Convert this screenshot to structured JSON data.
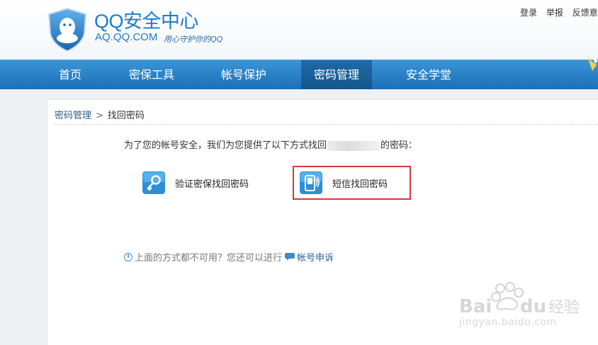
{
  "header": {
    "logo_title": "QQ安全中心",
    "logo_domain": "AQ.QQ.COM",
    "logo_slogan": "用心守护你的QQ",
    "top_links": [
      "登录",
      "举报",
      "反馈意见"
    ]
  },
  "nav": {
    "items": [
      {
        "label": "首页",
        "active": false
      },
      {
        "label": "密保工具",
        "active": false
      },
      {
        "label": "帐号保护",
        "active": false
      },
      {
        "label": "密码管理",
        "active": true
      },
      {
        "label": "安全学堂",
        "active": false
      }
    ]
  },
  "breadcrumb": {
    "parent": "密码管理",
    "separator": ">",
    "current": "找回密码"
  },
  "content": {
    "intro_prefix": "为了您的帐号安全，我们为您提供了以下方式找回",
    "intro_suffix": "的密码：",
    "options": [
      {
        "label": "验证密保找回密码",
        "icon": "key-icon"
      },
      {
        "label": "短信找回密码",
        "icon": "phone-icon"
      }
    ],
    "help_text": "上面的方式都不可用？您还可以进行",
    "appeal_link": "帐号申诉"
  },
  "watermark": {
    "logo": "Bai du 经验",
    "url": "jingyan.baidu.com"
  },
  "colors": {
    "brand_blue": "#1e7bc8",
    "nav_bg": "#1c6fb6",
    "nav_active": "#14558d",
    "highlight_border": "#d9363e"
  }
}
